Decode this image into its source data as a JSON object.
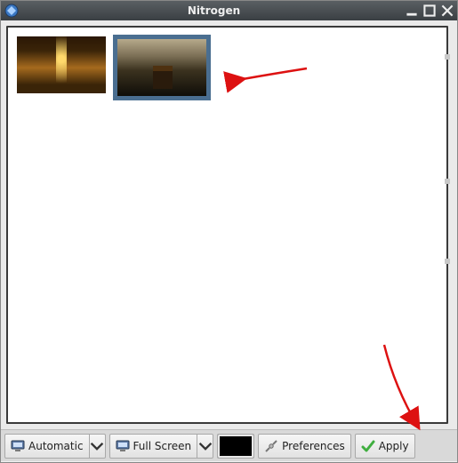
{
  "window": {
    "title": "Nitrogen"
  },
  "thumbnails": [
    {
      "name": "autumn-path",
      "selected": false
    },
    {
      "name": "house-sunset",
      "selected": true
    }
  ],
  "toolbar": {
    "mode_label": "Automatic",
    "screen_label": "Full Screen",
    "color_value": "#000000",
    "preferences_label": "Preferences",
    "apply_label": "Apply"
  },
  "annotations": {
    "arrow_top": "arrow pointing left at selected thumbnail",
    "arrow_bottom": "arrow pointing down-right at Apply button"
  }
}
